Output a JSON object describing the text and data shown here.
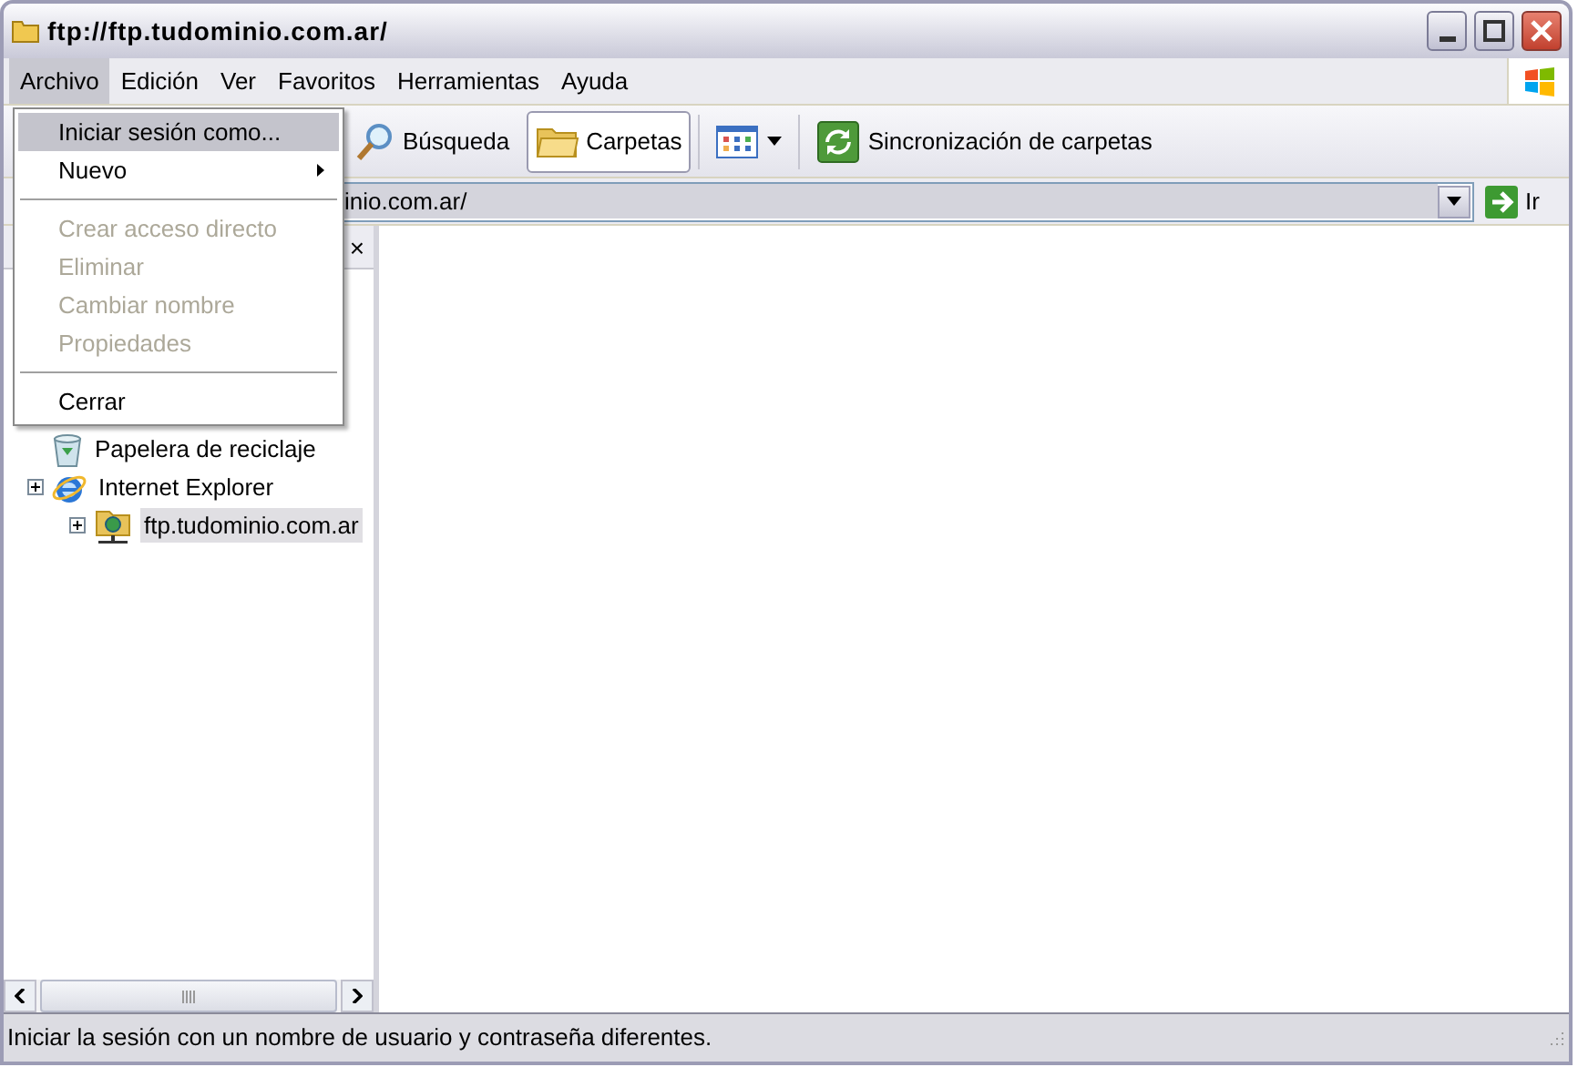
{
  "window": {
    "title": "ftp://ftp.tudominio.com.ar/"
  },
  "menu_bar": [
    {
      "label": "Archivo",
      "selected": true
    },
    {
      "label": "Edición",
      "selected": false
    },
    {
      "label": "Ver",
      "selected": false
    },
    {
      "label": "Favoritos",
      "selected": false
    },
    {
      "label": "Herramientas",
      "selected": false
    },
    {
      "label": "Ayuda",
      "selected": false
    }
  ],
  "open_menu": [
    {
      "kind": "item",
      "label": "Iniciar sesión como...",
      "selected": true,
      "disabled": false
    },
    {
      "kind": "submenu",
      "label": "Nuevo",
      "selected": false,
      "disabled": false
    },
    {
      "kind": "separator"
    },
    {
      "kind": "item",
      "label": "Crear acceso directo",
      "selected": false,
      "disabled": true
    },
    {
      "kind": "item",
      "label": "Eliminar",
      "selected": false,
      "disabled": true
    },
    {
      "kind": "item",
      "label": "Cambiar nombre",
      "selected": false,
      "disabled": true
    },
    {
      "kind": "item",
      "label": "Propiedades",
      "selected": false,
      "disabled": true
    },
    {
      "kind": "separator"
    },
    {
      "kind": "item",
      "label": "Cerrar",
      "selected": false,
      "disabled": false
    }
  ],
  "toolbar": [
    {
      "kind": "search",
      "label": "Búsqueda",
      "selected": false
    },
    {
      "kind": "folders",
      "label": "Carpetas",
      "selected": true
    },
    {
      "kind": "views",
      "selected": false
    },
    {
      "kind": "sync",
      "label": "Sincronización de carpetas",
      "selected": false
    }
  ],
  "address_bar": {
    "value": "inio.com.ar/",
    "go_label": "Ir"
  },
  "folder_pane": {
    "close": "×"
  },
  "tree": [
    {
      "kind": "recycle",
      "label": "Papelera de reciclaje",
      "collapsed": false,
      "selected": false
    },
    {
      "kind": "browser",
      "label": "Internet Explorer",
      "collapsed": true,
      "selected": false,
      "children": [
        {
          "kind": "ftp",
          "label": "ftp.tudominio.com.ar",
          "collapsed": true,
          "selected": true
        }
      ]
    }
  ],
  "status_bar": {
    "text": "Iniciar la sesión con un nombre de usuario y contraseña diferentes."
  }
}
